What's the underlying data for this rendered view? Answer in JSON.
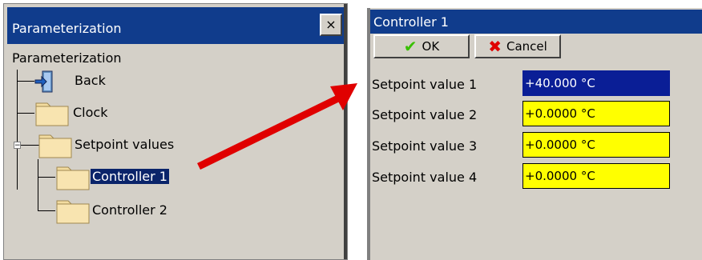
{
  "left_window": {
    "title": "Parameterization",
    "close_label": "×",
    "tree": {
      "root": "Parameterization",
      "items": [
        {
          "label": "Back",
          "icon": "back-door-icon"
        },
        {
          "label": "Clock",
          "icon": "folder-icon"
        },
        {
          "label": "Setpoint values",
          "icon": "folder-icon",
          "expander": "−"
        },
        {
          "label": "Controller 1",
          "icon": "folder-icon",
          "selected": true
        },
        {
          "label": "Controller 2",
          "icon": "folder-icon"
        }
      ]
    }
  },
  "right_window": {
    "title": "Controller 1",
    "ok_label": "OK",
    "cancel_label": "Cancel",
    "setpoints": [
      {
        "label": "Setpoint value 1",
        "value": "+40.000 °C",
        "active": true
      },
      {
        "label": "Setpoint value 2",
        "value": "+0.0000 °C"
      },
      {
        "label": "Setpoint value 3",
        "value": "+0.0000 °C"
      },
      {
        "label": "Setpoint value 4",
        "value": "+0.0000 °C"
      }
    ]
  },
  "colors": {
    "titlebar": "#103c8c",
    "window_bg": "#d4d0c8",
    "selection": "#0a246a",
    "field_yellow": "#ffff00",
    "field_active": "#0a1e96",
    "arrow": "#e00000",
    "check_green": "#38c000",
    "cancel_red": "#e00000"
  }
}
